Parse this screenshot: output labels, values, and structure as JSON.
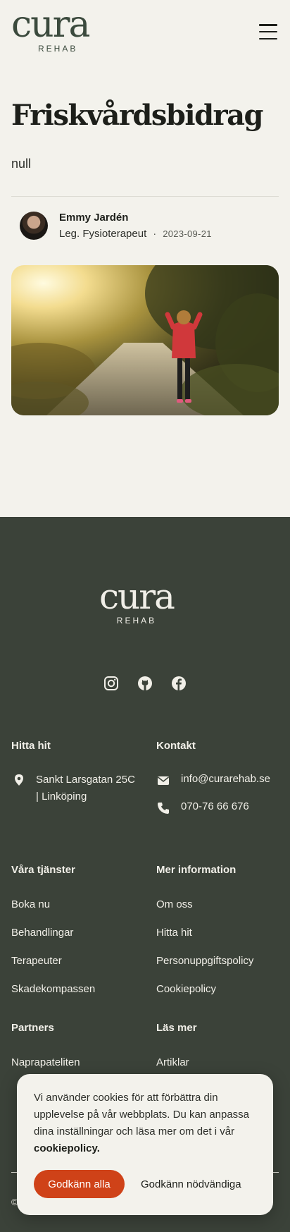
{
  "header": {
    "logo_word": "cura",
    "logo_sub": "REHAB",
    "menu_icon": "hamburger-menu-icon"
  },
  "article": {
    "title": "Friskvårdsbidrag",
    "lead": "null",
    "author_name": "Emmy Jardén",
    "author_role": "Leg. Fysioterapeut",
    "separator": "·",
    "date": "2023-09-21",
    "image_alt": "Woman walking on a sunlit path"
  },
  "footer": {
    "logo_word": "cura",
    "logo_sub": "REHAB",
    "social": [
      "instagram-icon",
      "github-icon",
      "facebook-icon"
    ],
    "find_us": {
      "heading": "Hitta hit",
      "address_line1": "Sankt Larsgatan 25C",
      "address_line2": "| Linköping"
    },
    "contact": {
      "heading": "Kontakt",
      "email": "info@curarehab.se",
      "phone": "070-76 66 676"
    },
    "services": {
      "heading": "Våra tjänster",
      "links": [
        "Boka nu",
        "Behandlingar",
        "Terapeuter",
        "Skadekompassen"
      ]
    },
    "more_info": {
      "heading": "Mer information",
      "links": [
        "Om oss",
        "Hitta hit",
        "Personuppgiftspolicy",
        "Cookiepolicy"
      ]
    },
    "partners": {
      "heading": "Partners",
      "links": [
        "Naprapateliten"
      ]
    },
    "read_more": {
      "heading": "Läs mer",
      "links": [
        "Artiklar"
      ]
    },
    "copyright": "©"
  },
  "cookie": {
    "text": "Vi använder cookies för att förbättra din upplevelse på vår webbplats. Du kan anpassa dina inställningar och läsa mer om det i vår",
    "link": "cookiepolicy.",
    "accept_all": "Godkänn alla",
    "accept_needed": "Godkänn nödvändiga"
  },
  "colors": {
    "background": "#f3f2ec",
    "footer": "#3b4239",
    "accent": "#cf4218"
  }
}
